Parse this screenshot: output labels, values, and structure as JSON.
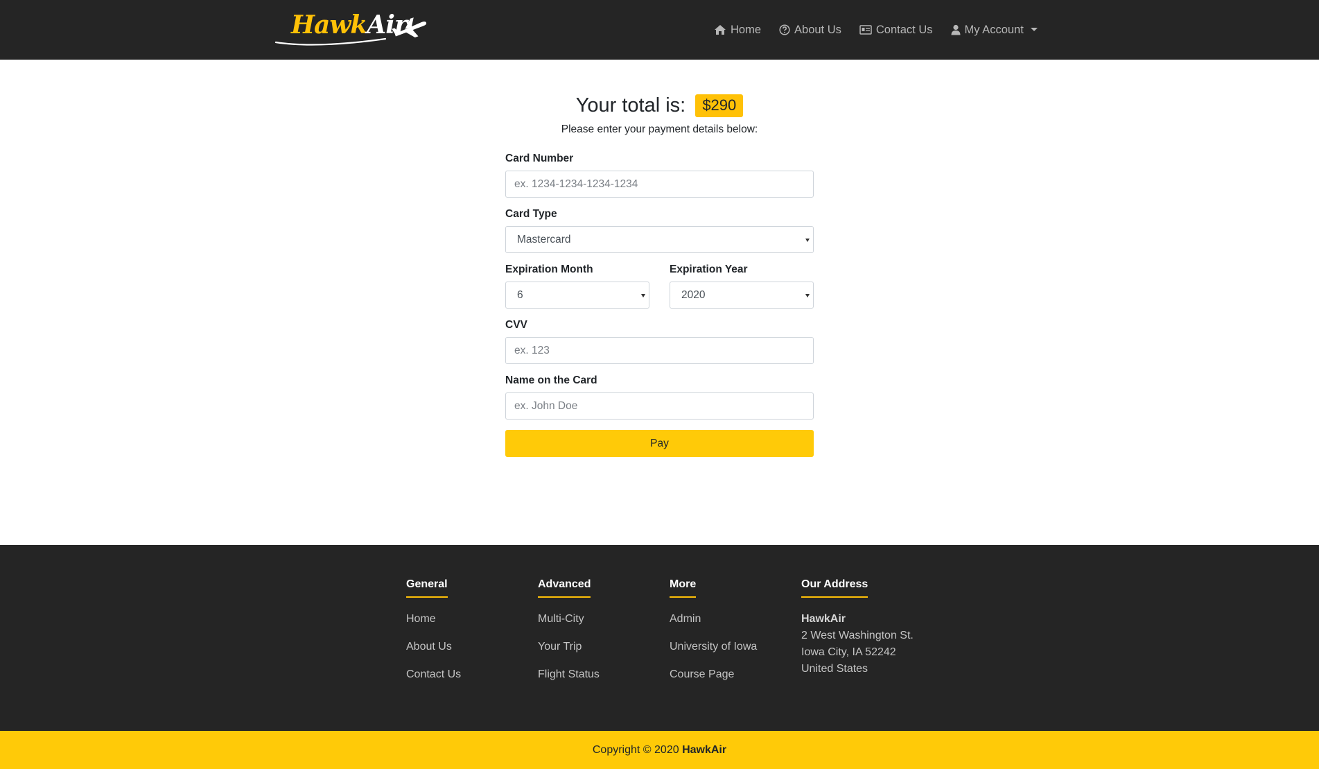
{
  "colors": {
    "accent": "#ffc107",
    "navbar_bg": "#252525",
    "footer_bg": "#252525",
    "button_bg": "#ffca08"
  },
  "header": {
    "brand_part1": "Hawk",
    "brand_part2": "Air",
    "nav": [
      {
        "label": "Home",
        "icon": "home-icon"
      },
      {
        "label": "About Us",
        "icon": "question-circle-icon"
      },
      {
        "label": "Contact Us",
        "icon": "id-card-icon"
      },
      {
        "label": "My Account",
        "icon": "user-icon"
      }
    ]
  },
  "payment": {
    "total_label": "Your total is:",
    "total_amount": "$290",
    "subtitle": "Please enter your payment details below:",
    "card_number": {
      "label": "Card Number",
      "placeholder": "ex. 1234-1234-1234-1234",
      "value": ""
    },
    "card_type": {
      "label": "Card Type",
      "selected": "Mastercard"
    },
    "exp_month": {
      "label": "Expiration Month",
      "selected": "6"
    },
    "exp_year": {
      "label": "Expiration Year",
      "selected": "2020"
    },
    "cvv": {
      "label": "CVV",
      "placeholder": "ex. 123",
      "value": ""
    },
    "name_on_card": {
      "label": "Name on the Card",
      "placeholder": "ex. John Doe",
      "value": ""
    },
    "pay_label": "Pay"
  },
  "footer": {
    "general": {
      "heading": "General",
      "links": [
        "Home",
        "About Us",
        "Contact Us"
      ]
    },
    "advanced": {
      "heading": "Advanced",
      "links": [
        "Multi-City",
        "Your Trip",
        "Flight Status"
      ]
    },
    "more": {
      "heading": "More",
      "links": [
        "Admin",
        "University of Iowa",
        "Course Page"
      ]
    },
    "address": {
      "heading": "Our Address",
      "name": "HawkAir",
      "lines": [
        "2 West Washington St.",
        "Iowa City, IA 52242",
        "United States"
      ]
    },
    "copyright_prefix": "Copyright © 2020",
    "copyright_brand": "HawkAir"
  }
}
